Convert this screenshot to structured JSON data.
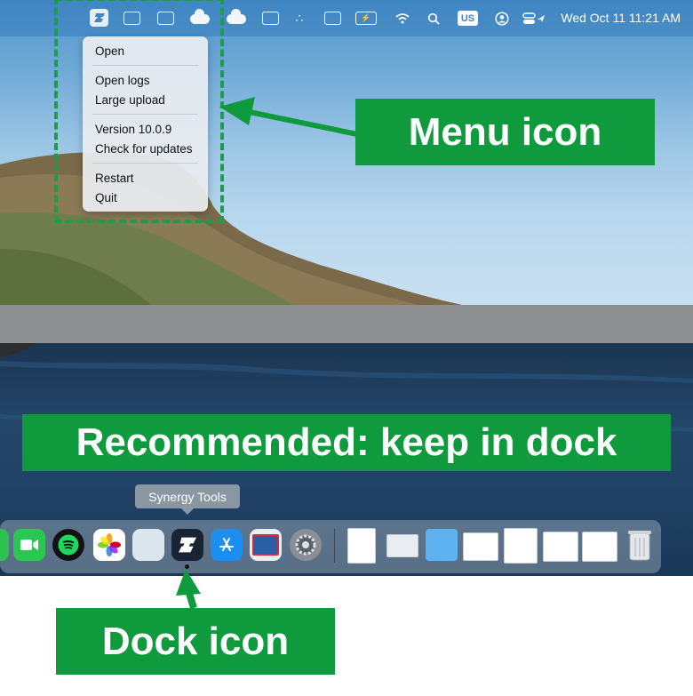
{
  "menubar": {
    "keyboard_layout": "US",
    "datetime": "Wed Oct 11  11:21 AM"
  },
  "dropdown_menu": {
    "items": [
      "Open",
      "Open logs",
      "Large upload",
      "Version 10.0.9",
      "Check for updates",
      "Restart",
      "Quit"
    ]
  },
  "dock": {
    "tooltip": "Synergy Tools"
  },
  "callouts": {
    "menu_icon": "Menu icon",
    "recommendation": "Recommended: keep in dock",
    "dock_icon": "Dock icon"
  },
  "colors": {
    "callout_green": "#0f9a3d",
    "menubar_blue": "#3f86c2"
  }
}
